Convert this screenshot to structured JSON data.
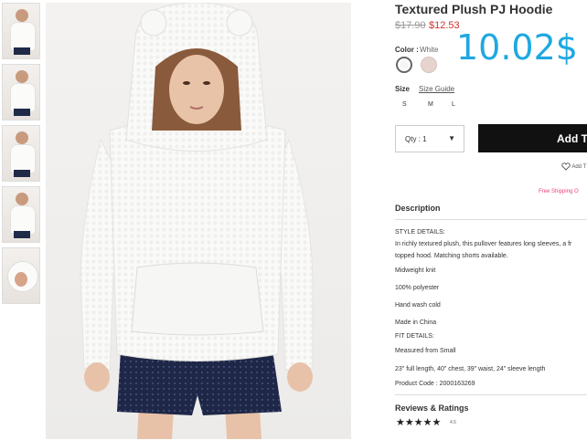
{
  "product": {
    "title": "Textured Plush PJ Hoodie",
    "old_price": "$17.90",
    "new_price": "$12.53",
    "overlay_price": "10.02$",
    "color_label": "Color :",
    "color_value": "White",
    "swatches": [
      {
        "name": "White",
        "hex": "#f5f5f3"
      },
      {
        "name": "Pink",
        "hex": "#e8d4cf"
      }
    ],
    "size_label": "Size",
    "size_guide": "Size Guide",
    "sizes": [
      "S",
      "M",
      "L"
    ],
    "qty_label": "Qty : 1",
    "add_button": "Add T",
    "wishlist": "Add T",
    "free_shipping": "Free Shipping O"
  },
  "description": {
    "heading": "Description",
    "style_details_heading": "STYLE DETAILS:",
    "style_line1": "In richly textured plush, this pullover features long sleeves, a fr",
    "style_line2": "topped hood. Matching shorts available.",
    "midweight": "Midweight knit",
    "material": "100% polyester",
    "care": "Hand wash cold",
    "origin": "Made in China",
    "fit_heading": "FIT DETAILS:",
    "fit_measured": "Measured from Small",
    "fit_dims": "23\" full length, 40\" chest, 39\" waist, 24\" sleeve length",
    "product_code": "Product Code : 2000163269"
  },
  "reviews": {
    "heading": "Reviews & Ratings",
    "stars": "★★★★★",
    "rating": "4.5"
  },
  "colors": {
    "sale_red": "#d0312d",
    "overlay_blue": "#1fa8e1",
    "button_black": "#111111",
    "shipping_pink": "#e8437a"
  }
}
